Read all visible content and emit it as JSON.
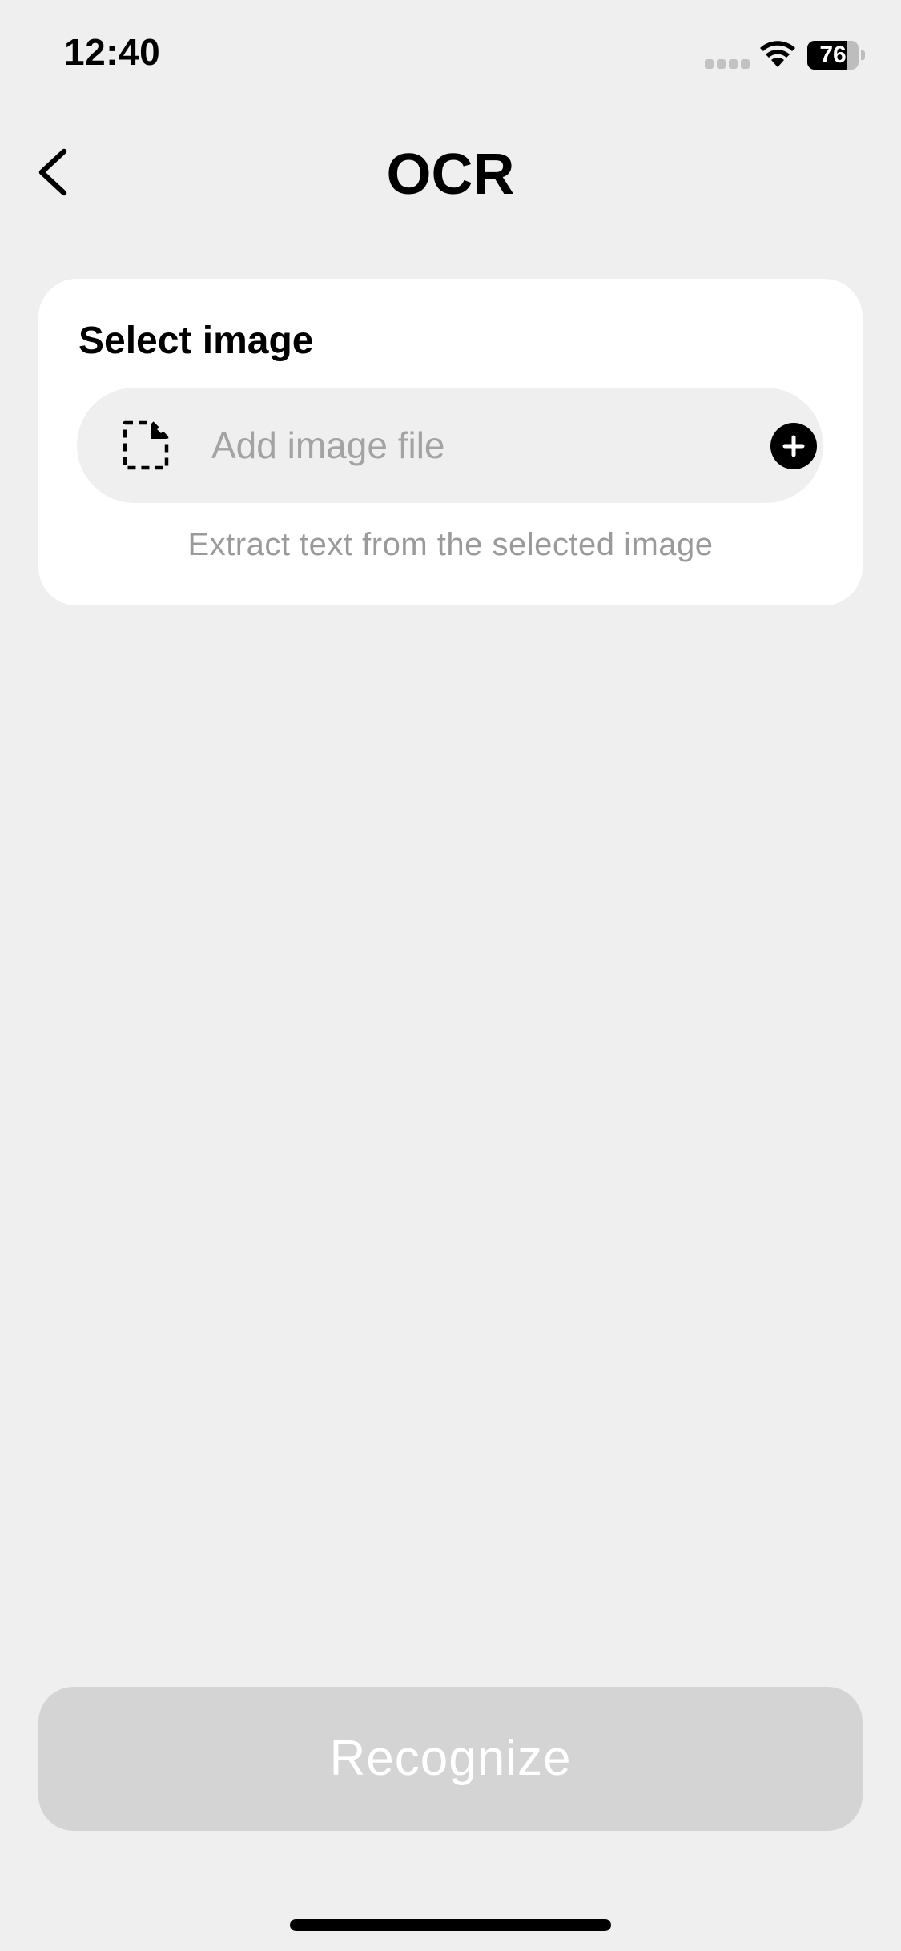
{
  "status_bar": {
    "time": "12:40",
    "battery_level": "76",
    "icons": [
      "signal-icon",
      "wifi-icon",
      "battery-icon"
    ]
  },
  "header": {
    "back_icon": "chevron-left-icon",
    "title": "OCR"
  },
  "select_image_card": {
    "title": "Select image",
    "file_input": {
      "icon": "dashed-file-icon",
      "placeholder": "Add image file",
      "add_icon": "plus-circle-icon"
    },
    "hint": "Extract text from the selected image"
  },
  "actions": {
    "recognize_label": "Recognize",
    "recognize_enabled": false
  },
  "colors": {
    "background": "#efefef",
    "card": "#ffffff",
    "input_bg": "#efefef",
    "placeholder_text": "#a3a3a3",
    "hint_text": "#9a9a9a",
    "disabled_button": "#d4d4d4",
    "accent": "#000000"
  }
}
